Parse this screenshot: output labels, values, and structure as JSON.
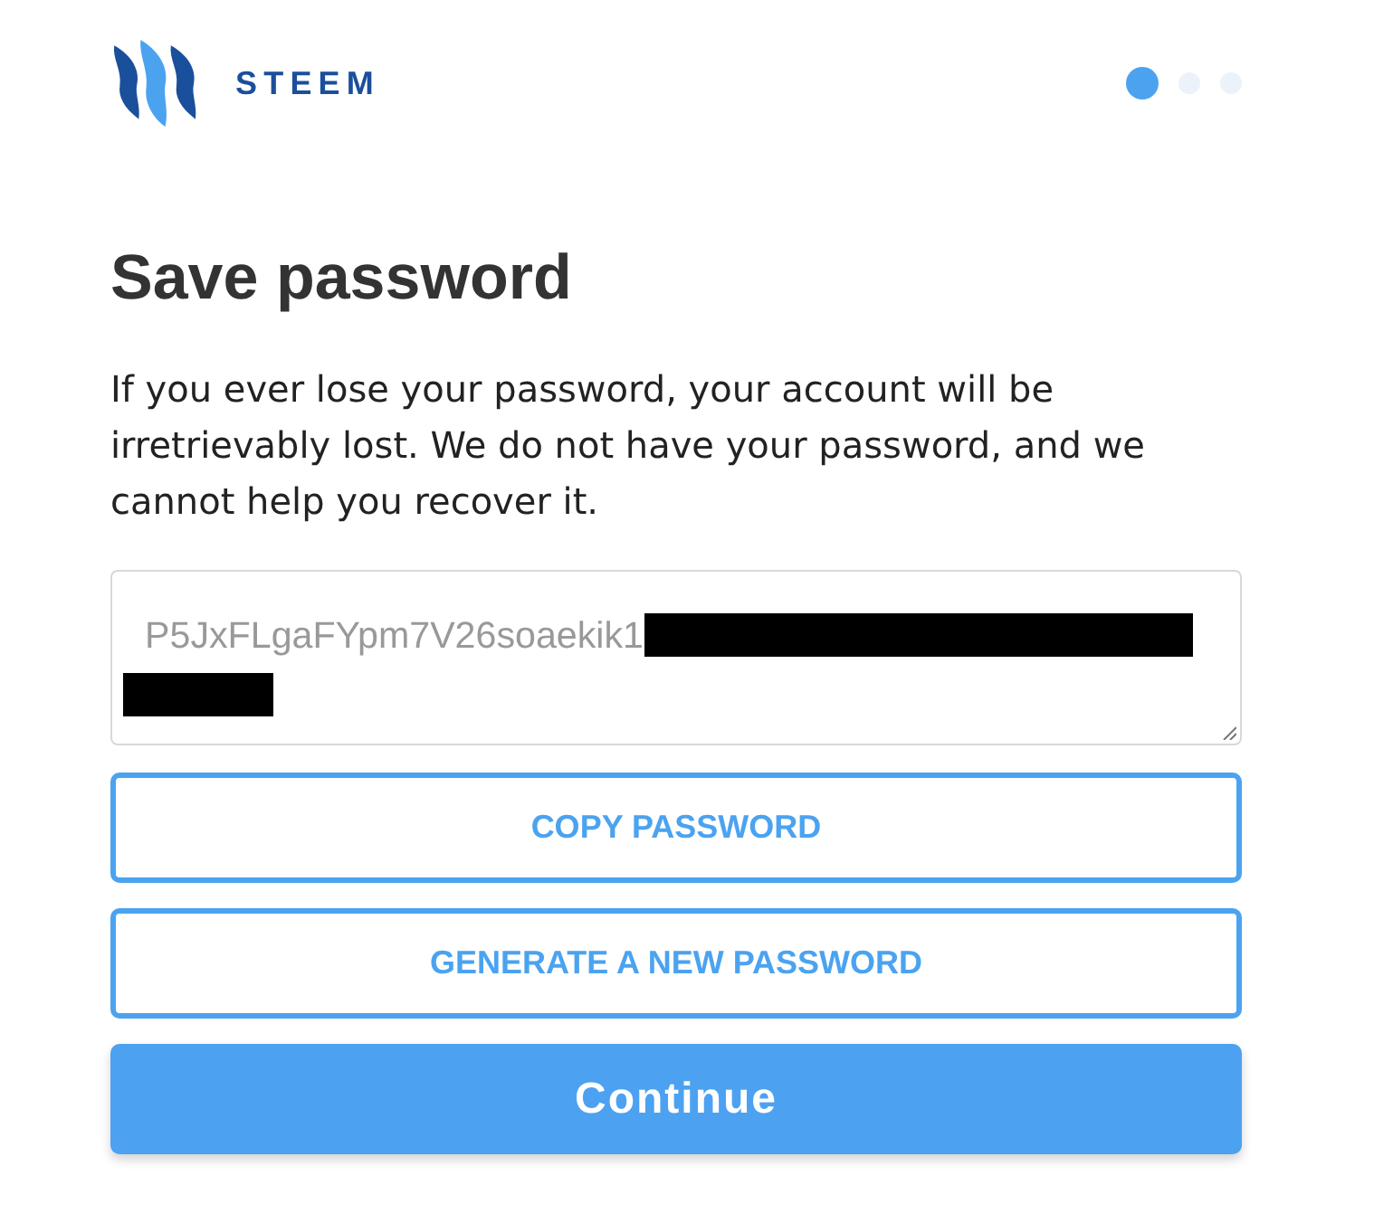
{
  "logo": {
    "wordmark": "STEEM"
  },
  "steps": [
    {
      "selected": true
    },
    {
      "selected": false
    },
    {
      "selected": false
    }
  ],
  "title": "Save password",
  "warning": "If you ever lose your password, your account will be irretrievably lost. We do not have your password, and we cannot help you recover it.",
  "password_field": {
    "value": "P5JxFLgaFYpm7V26soaekik1",
    "redacted": true
  },
  "buttons": [
    {
      "label": "COPY PASSWORD",
      "kind": "outline"
    },
    {
      "label": "GENERATE A NEW PASSWORD",
      "kind": "outline"
    },
    {
      "label": "Continue",
      "kind": "primary"
    }
  ]
}
